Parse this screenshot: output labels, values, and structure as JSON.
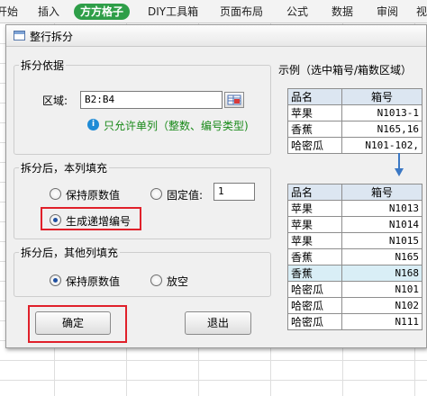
{
  "ribbon": {
    "tabs": [
      "开始",
      "插入",
      "方方格子",
      "DIY工具箱",
      "页面布局",
      "公式",
      "数据",
      "审阅",
      "视"
    ]
  },
  "dialog": {
    "title": "整行拆分",
    "basis": {
      "title": "拆分依据",
      "range_label": "区域:",
      "range_value": "B2:B4",
      "hint": "只允许单列（整数、编号类型)"
    },
    "fill_this": {
      "title": "拆分后，本列填充",
      "opt_keep": "保持原数值",
      "opt_fixed": "固定值:",
      "fixed_value": "1",
      "opt_increment": "生成递增编号"
    },
    "fill_other": {
      "title": "拆分后，其他列填充",
      "opt_keep": "保持原数值",
      "opt_blank": "放空"
    },
    "ok": "确定",
    "cancel": "退出",
    "example": {
      "title": "示例（选中箱号/箱数区域）",
      "before": {
        "headers": [
          "品名",
          "箱号"
        ],
        "rows": [
          [
            "苹果",
            "N1013-1"
          ],
          [
            "香蕉",
            "N165,16"
          ],
          [
            "哈密瓜",
            "N101-102,"
          ]
        ]
      },
      "after": {
        "headers": [
          "品名",
          "箱号"
        ],
        "rows": [
          [
            "苹果",
            "N1013"
          ],
          [
            "苹果",
            "N1014"
          ],
          [
            "苹果",
            "N1015"
          ],
          [
            "香蕉",
            "N165"
          ],
          [
            "香蕉",
            "N168"
          ],
          [
            "哈密瓜",
            "N101"
          ],
          [
            "哈密瓜",
            "N102"
          ],
          [
            "哈密瓜",
            "N111"
          ]
        ]
      }
    }
  },
  "colors": {
    "accent": "#2e9e48",
    "highlight": "#e0202a",
    "header_fill": "#dce6f1",
    "row_highlight": "#d9eef6"
  }
}
